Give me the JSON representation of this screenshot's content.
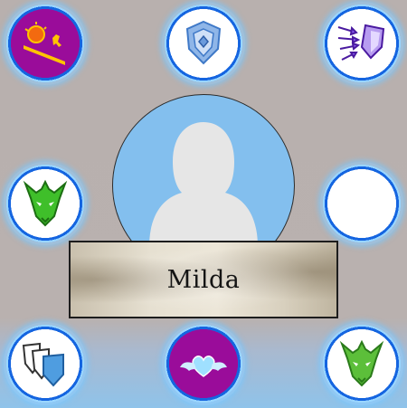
{
  "character": {
    "name": "Milda"
  },
  "slots": {
    "top_left": {
      "icon": "sun-over-slope-icon",
      "fill": "#9a0c9a"
    },
    "top_center": {
      "icon": "blue-emblem-shield-icon",
      "fill": "#ffffff"
    },
    "top_right": {
      "icon": "arrows-into-shield-icon",
      "fill": "#ffffff"
    },
    "middle_left": {
      "icon": "green-dragon-head-icon",
      "fill": "#ffffff"
    },
    "middle_right": {
      "icon": "empty-slot",
      "fill": "#ffffff"
    },
    "bottom_left": {
      "icon": "stacked-shields-icon",
      "fill": "#ffffff"
    },
    "bottom_center": {
      "icon": "winged-heart-icon",
      "fill": "#9a0c9a"
    },
    "bottom_right": {
      "icon": "green-dragon-head-icon",
      "fill": "#ffffff"
    }
  },
  "colors": {
    "slot_ring": "#1565e0",
    "slot_glow": "#9ad6ff",
    "portrait_bg": "#83bfee",
    "silhouette": "#e6e6e6"
  }
}
